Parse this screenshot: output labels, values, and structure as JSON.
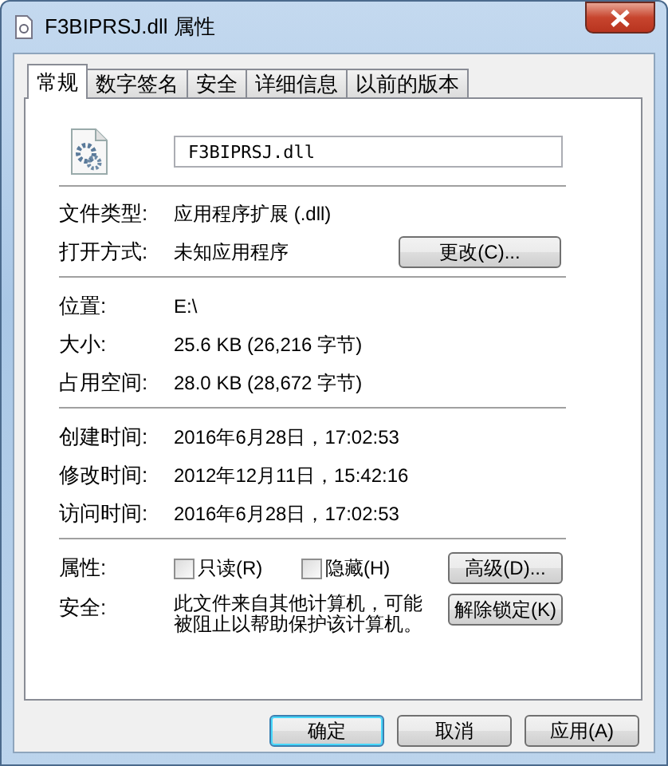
{
  "window": {
    "title": "F3BIPRSJ.dll 属性"
  },
  "tabs": [
    {
      "label": "常规",
      "selected": true
    },
    {
      "label": "数字签名",
      "selected": false
    },
    {
      "label": "安全",
      "selected": false
    },
    {
      "label": "详细信息",
      "selected": false
    },
    {
      "label": "以前的版本",
      "selected": false
    }
  ],
  "file": {
    "name": "F3BIPRSJ.dll"
  },
  "sections": [
    [
      {
        "label": "文件类型:",
        "value": "应用程序扩展 (.dll)"
      },
      {
        "label": "打开方式:",
        "value": "未知应用程序",
        "button": "更改(C)..."
      }
    ],
    [
      {
        "label": "位置:",
        "value": "E:\\"
      },
      {
        "label": "大小:",
        "value": "25.6 KB (26,216 字节)"
      },
      {
        "label": "占用空间:",
        "value": "28.0 KB (28,672 字节)"
      }
    ],
    [
      {
        "label": "创建时间:",
        "value": "2016年6月28日，17:02:53"
      },
      {
        "label": "修改时间:",
        "value": "2012年12月11日，15:42:16"
      },
      {
        "label": "访问时间:",
        "value": "2016年6月28日，17:02:53"
      }
    ]
  ],
  "attributes": {
    "label": "属性:",
    "checkboxes": [
      {
        "label": "只读(R)",
        "checked": false
      },
      {
        "label": "隐藏(H)",
        "checked": false
      }
    ],
    "button": "高级(D)..."
  },
  "security": {
    "label": "安全:",
    "text": "此文件来自其他计算机，可能被阻止以帮助保护该计算机。",
    "button": "解除锁定(K)"
  },
  "buttons": [
    {
      "label": "确定",
      "default": true
    },
    {
      "label": "取消",
      "default": false
    },
    {
      "label": "应用(A)",
      "default": false
    }
  ]
}
